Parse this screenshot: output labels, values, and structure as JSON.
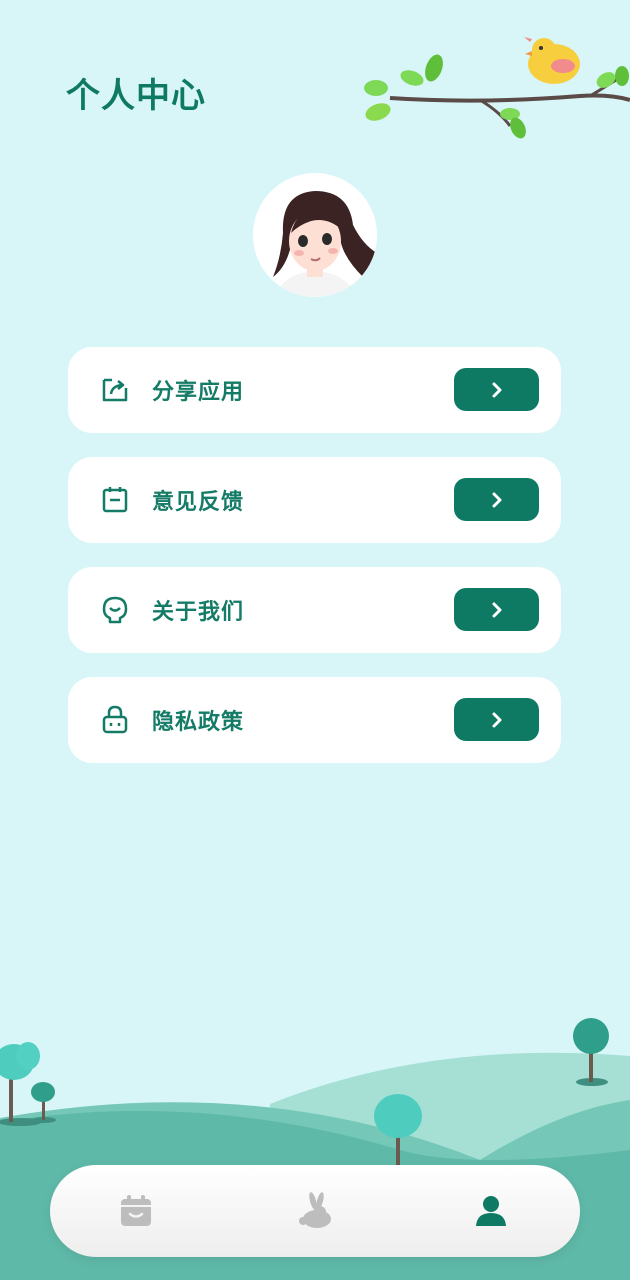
{
  "header": {
    "title": "个人中心"
  },
  "menu": {
    "items": [
      {
        "label": "分享应用",
        "icon": "share-icon"
      },
      {
        "label": "意见反馈",
        "icon": "feedback-icon"
      },
      {
        "label": "关于我们",
        "icon": "about-icon"
      },
      {
        "label": "隐私政策",
        "icon": "lock-icon"
      }
    ]
  },
  "tabbar": {
    "tabs": [
      {
        "icon": "calendar-icon",
        "active": false
      },
      {
        "icon": "rabbit-icon",
        "active": false
      },
      {
        "icon": "profile-icon",
        "active": true
      }
    ]
  },
  "colors": {
    "background": "#d8f6f8",
    "accent": "#0e7a64",
    "card": "#ffffff",
    "inactive_icon": "#bdbdbd"
  }
}
